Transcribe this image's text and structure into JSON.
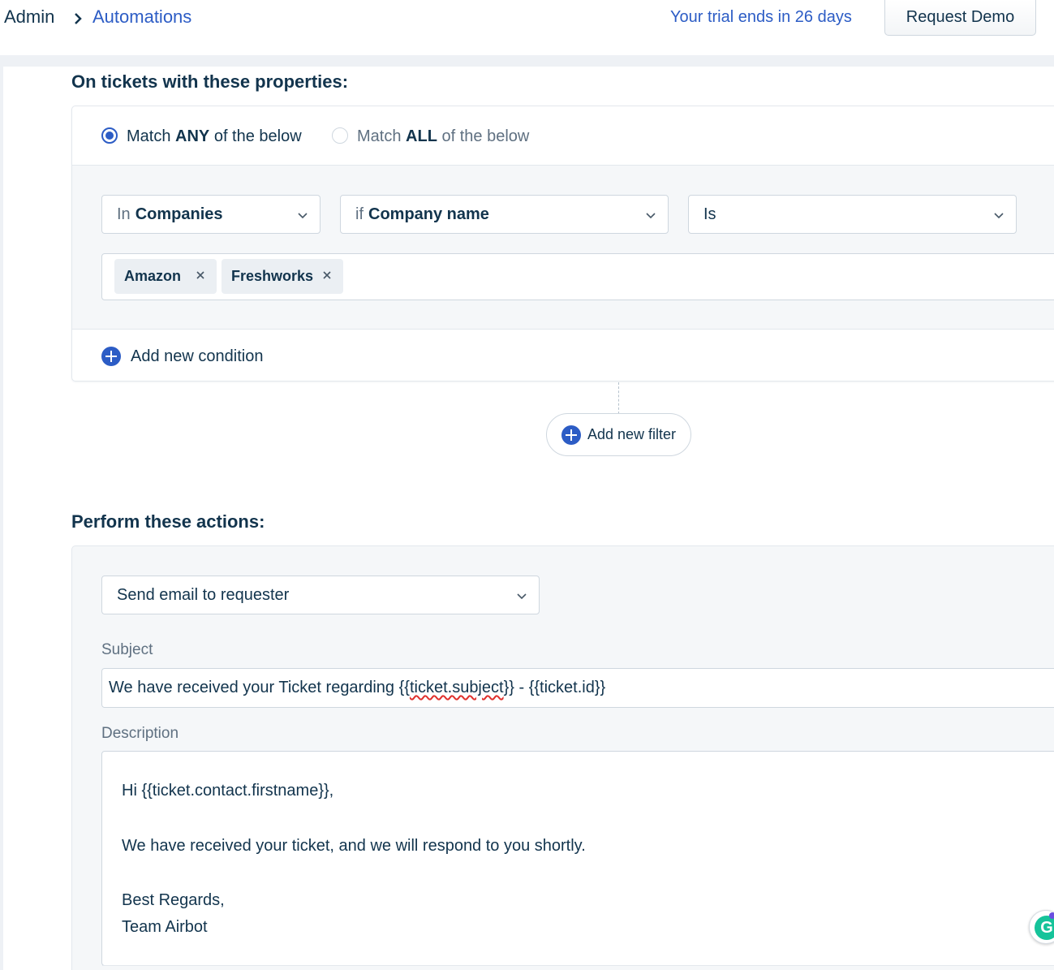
{
  "header": {
    "breadcrumb_root": "Admin",
    "breadcrumb_current": "Automations",
    "trial_text": "Your trial ends in 26 days",
    "request_demo": "Request Demo"
  },
  "conditions": {
    "title": "On tickets with these properties:",
    "match_any": {
      "prefix": "Match ",
      "keyword": "ANY",
      "suffix": " of the below",
      "selected": true
    },
    "match_all": {
      "prefix": "Match ",
      "keyword": "ALL",
      "suffix": " of the below",
      "selected": false
    },
    "entity_select": {
      "prefix": "In",
      "value": "Companies"
    },
    "field_select": {
      "prefix": "if",
      "value": "Company name"
    },
    "operator_select": {
      "value": "Is"
    },
    "values": [
      "Amazon",
      "Freshworks"
    ],
    "add_condition": "Add new condition",
    "add_filter": "Add new filter"
  },
  "actions": {
    "title": "Perform these actions:",
    "action_select": "Send email to requester",
    "subject_label": "Subject",
    "subject": {
      "before": "We have received your Ticket regarding {{",
      "flagged": "ticket.subject",
      "after": "}} - {{ticket.id}}"
    },
    "description_label": "Description",
    "description_lines": [
      "Hi {{ticket.contact.firstname}},",
      "We have received your ticket, and we will respond to you shortly.",
      "Best Regards,",
      "Team Airbot"
    ]
  },
  "colors": {
    "primary": "#2c5cc5",
    "text": "#12344d",
    "muted": "#5f7081",
    "border": "#cfd7df",
    "panel": "#f5f7f9"
  },
  "icons": {
    "breadcrumb_sep": "chevron-right-icon",
    "select_arrow": "chevron-down-icon",
    "tag_remove": "close-icon",
    "add": "plus-circle-icon",
    "assistant": "grammarly-icon"
  }
}
